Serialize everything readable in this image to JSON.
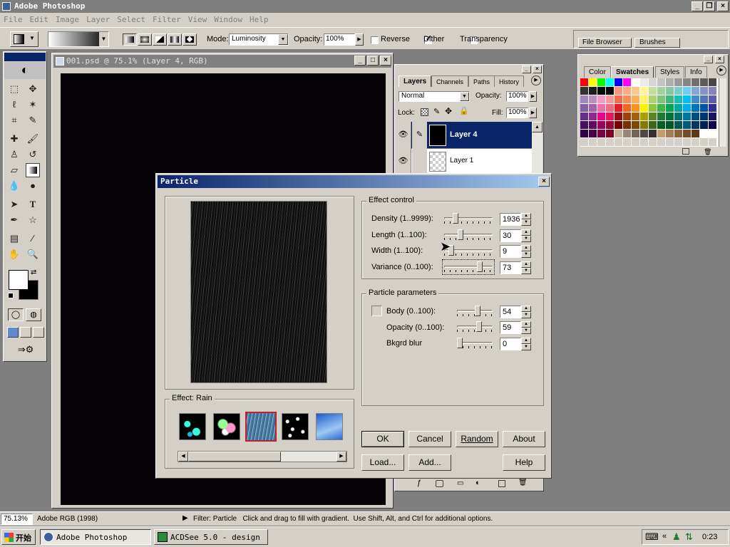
{
  "app": {
    "title": "Adobe Photoshop",
    "menu": [
      "File",
      "Edit",
      "Image",
      "Layer",
      "Select",
      "Filter",
      "View",
      "Window",
      "Help"
    ]
  },
  "options": {
    "mode_label": "Mode:",
    "mode_value": "Luminosity",
    "opacity_label": "Opacity:",
    "opacity_value": "100%",
    "reverse_label": "Reverse",
    "dither_label": "Dither",
    "transparency_label": "Transparency",
    "file_browser_tab": "File Browser",
    "brushes_tab": "Brushes"
  },
  "document": {
    "title": "001.psd @ 75.1% (Layer 4, RGB)"
  },
  "layers_palette": {
    "tabs": [
      "Layers",
      "Channels",
      "Paths",
      "History"
    ],
    "blend_mode": "Normal",
    "opacity_label": "Opacity:",
    "opacity_value": "100%",
    "lock_label": "Lock:",
    "fill_label": "Fill:",
    "fill_value": "100%",
    "layers": [
      {
        "name": "Layer 4",
        "selected": true
      },
      {
        "name": "Layer 1",
        "selected": false
      }
    ]
  },
  "swatches_palette": {
    "tabs": [
      "Color",
      "Swatches",
      "Styles",
      "Info"
    ]
  },
  "dialog": {
    "title": "Particle",
    "effect_control": {
      "label": "Effect control",
      "rows": [
        {
          "label": "Density (1..9999):",
          "value": "1936"
        },
        {
          "label": "Length (1..100):",
          "value": "30"
        },
        {
          "label": "Width (1..100):",
          "value": "9"
        },
        {
          "label": "Variance (0..100):",
          "value": "73"
        }
      ]
    },
    "particle_params": {
      "label": "Particle parameters",
      "rows": [
        {
          "label": "Body (0..100):",
          "value": "54"
        },
        {
          "label": "Opacity (0..100):",
          "value": "59"
        },
        {
          "label": "Bkgrd blur",
          "value": "0"
        }
      ]
    },
    "effect_label": "Effect: Rain",
    "buttons": {
      "ok": "OK",
      "cancel": "Cancel",
      "random": "Random",
      "about": "About",
      "load": "Load...",
      "add": "Add...",
      "help": "Help"
    }
  },
  "status": {
    "zoom": "75.13%",
    "profile": "Adobe RGB (1998)",
    "message": "Filter: Particle   Click and drag to fill with gradient.  Use Shift, Alt, and Ctrl for additional options."
  },
  "taskbar": {
    "start": "开始",
    "tasks": [
      "Adobe Photoshop",
      "ACDSee 5.0 - design"
    ],
    "clock": "0:23"
  }
}
